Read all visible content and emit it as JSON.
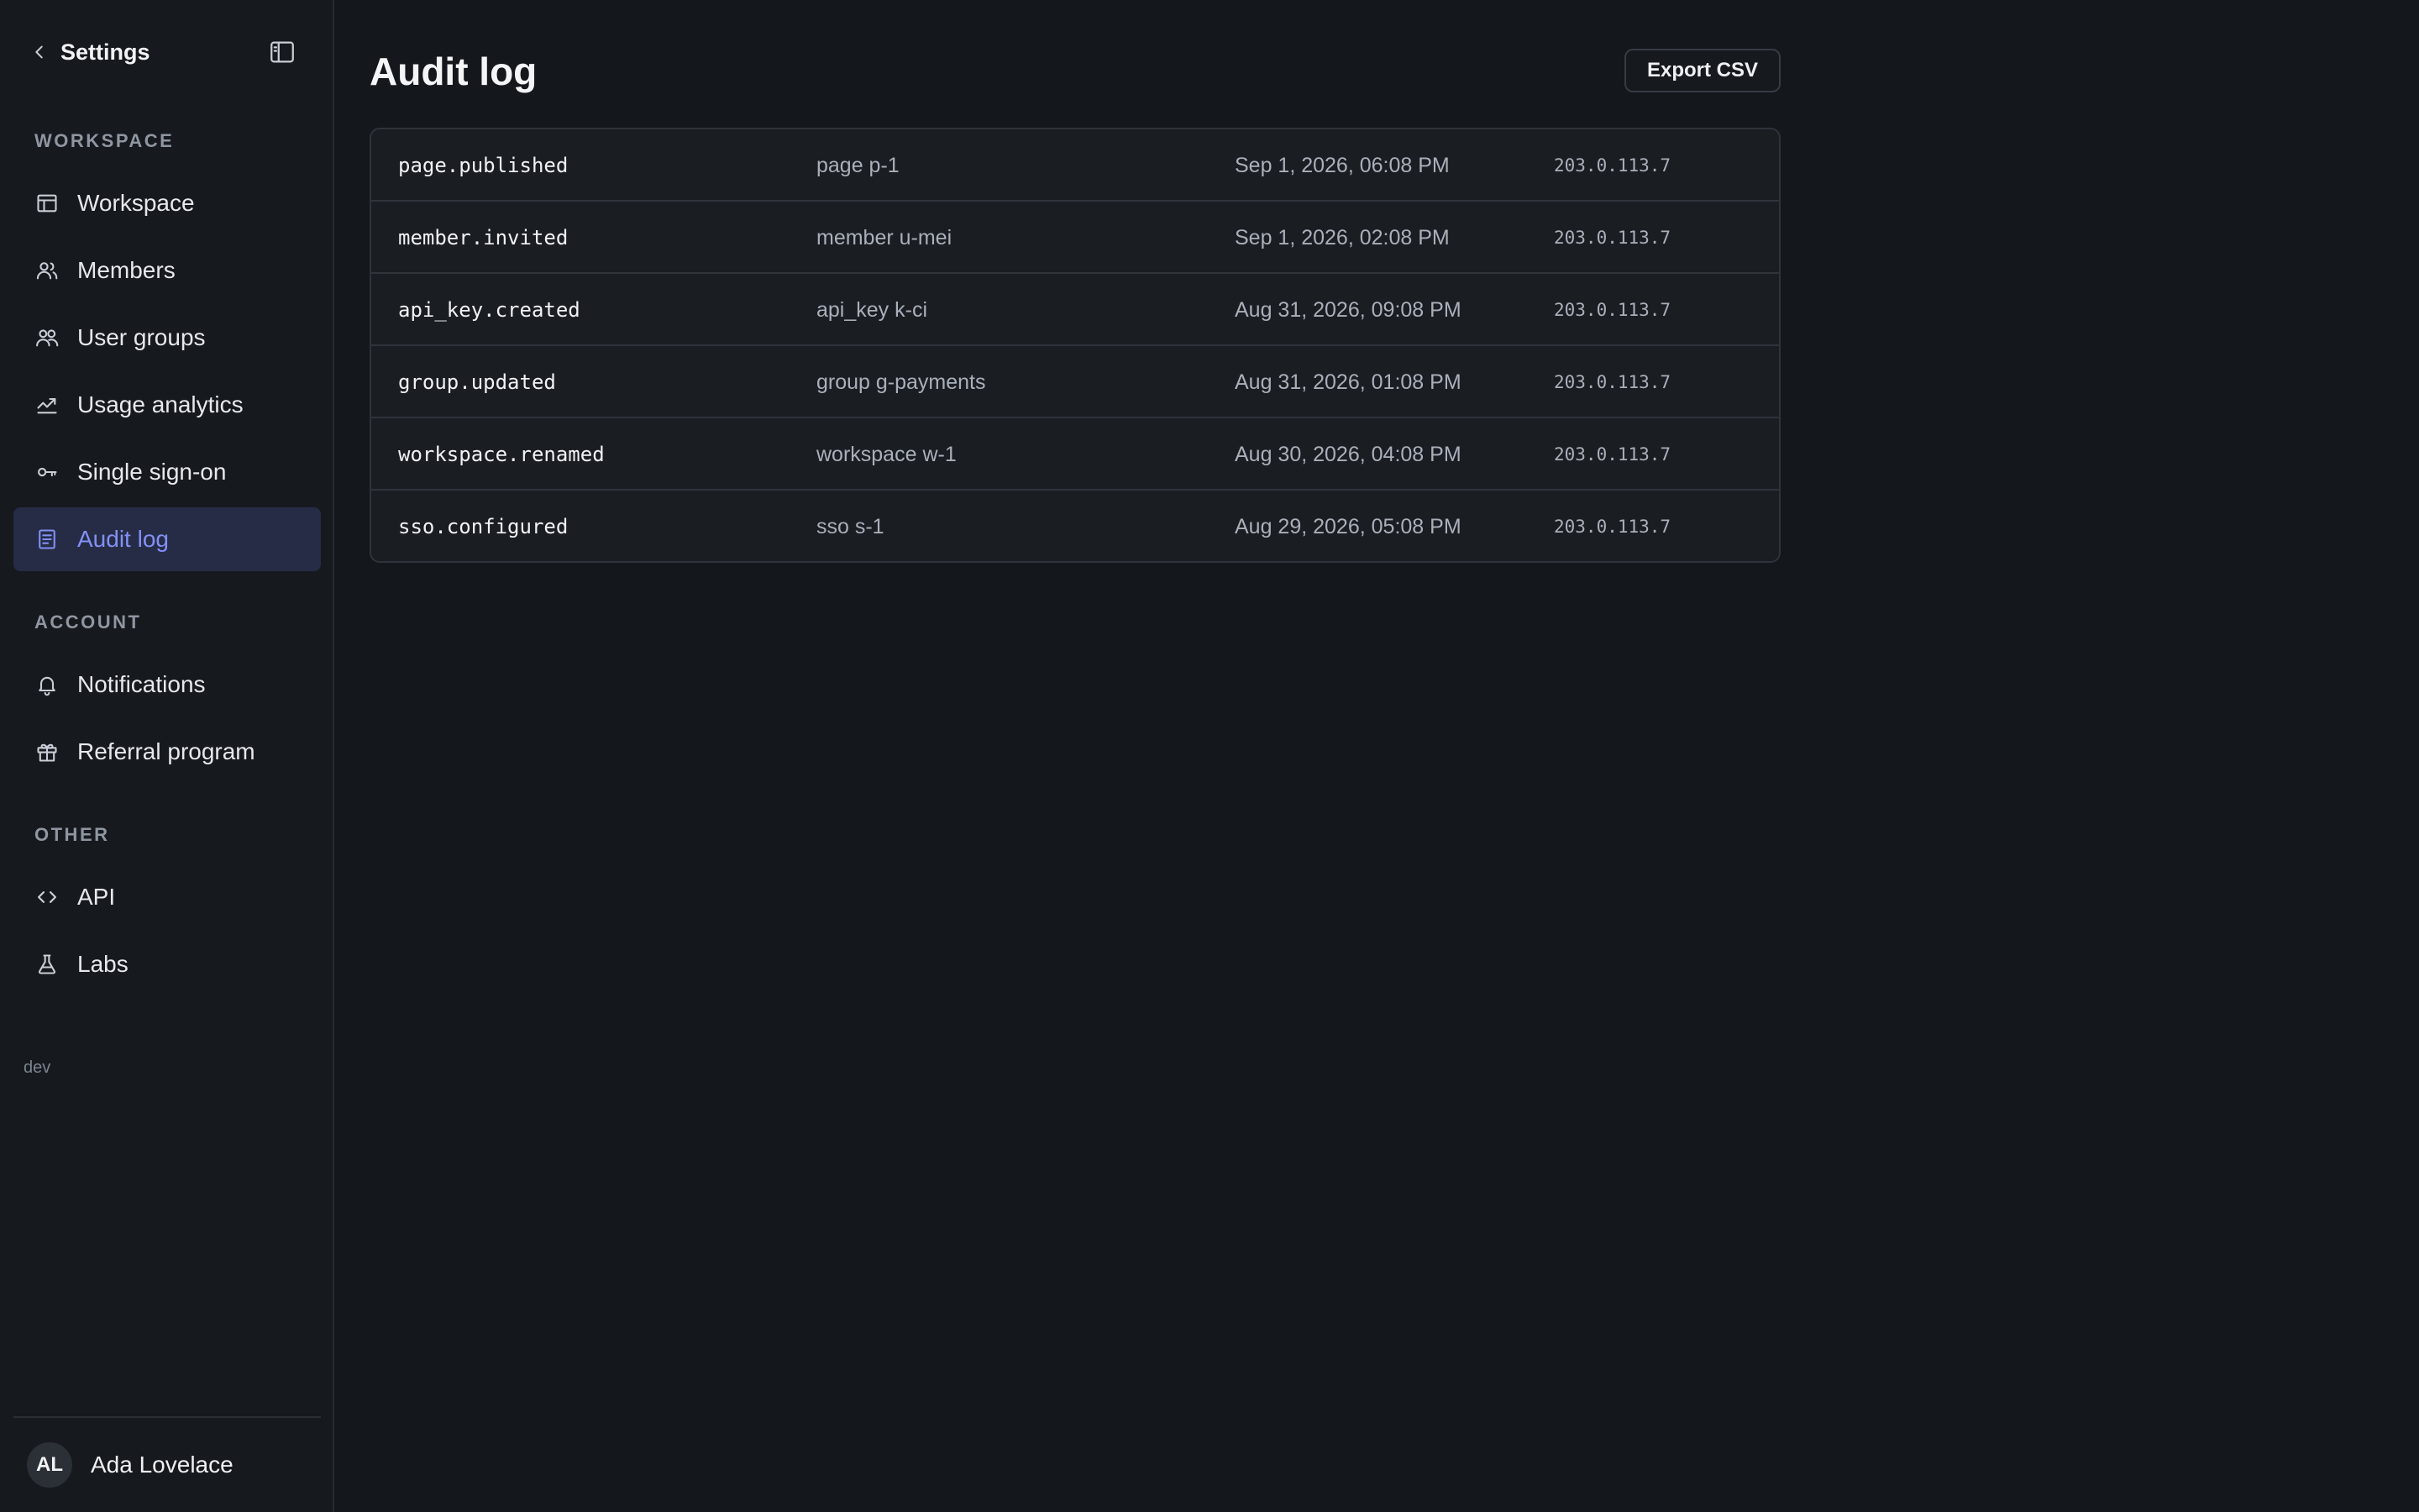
{
  "sidebar": {
    "back_label": "Settings",
    "sections": {
      "workspace": "WORKSPACE",
      "account": "ACCOUNT",
      "other": "OTHER"
    },
    "items": {
      "workspace": "Workspace",
      "members": "Members",
      "user_groups": "User groups",
      "usage_analytics": "Usage analytics",
      "single_sign_on": "Single sign-on",
      "audit_log": "Audit log",
      "notifications": "Notifications",
      "referral_program": "Referral program",
      "api": "API",
      "labs": "Labs"
    },
    "active_item": "Audit log",
    "env_tag": "dev",
    "user": {
      "initials": "AL",
      "name": "Ada Lovelace"
    }
  },
  "main": {
    "title": "Audit log",
    "export_label": "Export CSV",
    "rows": [
      {
        "action": "page.published",
        "target": "page p-1",
        "time": "Sep 1, 2026, 06:08 PM",
        "ip": "203.0.113.7"
      },
      {
        "action": "member.invited",
        "target": "member u-mei",
        "time": "Sep 1, 2026, 02:08 PM",
        "ip": "203.0.113.7"
      },
      {
        "action": "api_key.created",
        "target": "api_key k-ci",
        "time": "Aug 31, 2026, 09:08 PM",
        "ip": "203.0.113.7"
      },
      {
        "action": "group.updated",
        "target": "group g-payments",
        "time": "Aug 31, 2026, 01:08 PM",
        "ip": "203.0.113.7"
      },
      {
        "action": "workspace.renamed",
        "target": "workspace w-1",
        "time": "Aug 30, 2026, 04:08 PM",
        "ip": "203.0.113.7"
      },
      {
        "action": "sso.configured",
        "target": "sso s-1",
        "time": "Aug 29, 2026, 05:08 PM",
        "ip": "203.0.113.7"
      }
    ]
  },
  "colors": {
    "background": "#14171c",
    "sidebar": "#16191e",
    "accent": "#8390f5",
    "active_bg": "#262c45"
  }
}
